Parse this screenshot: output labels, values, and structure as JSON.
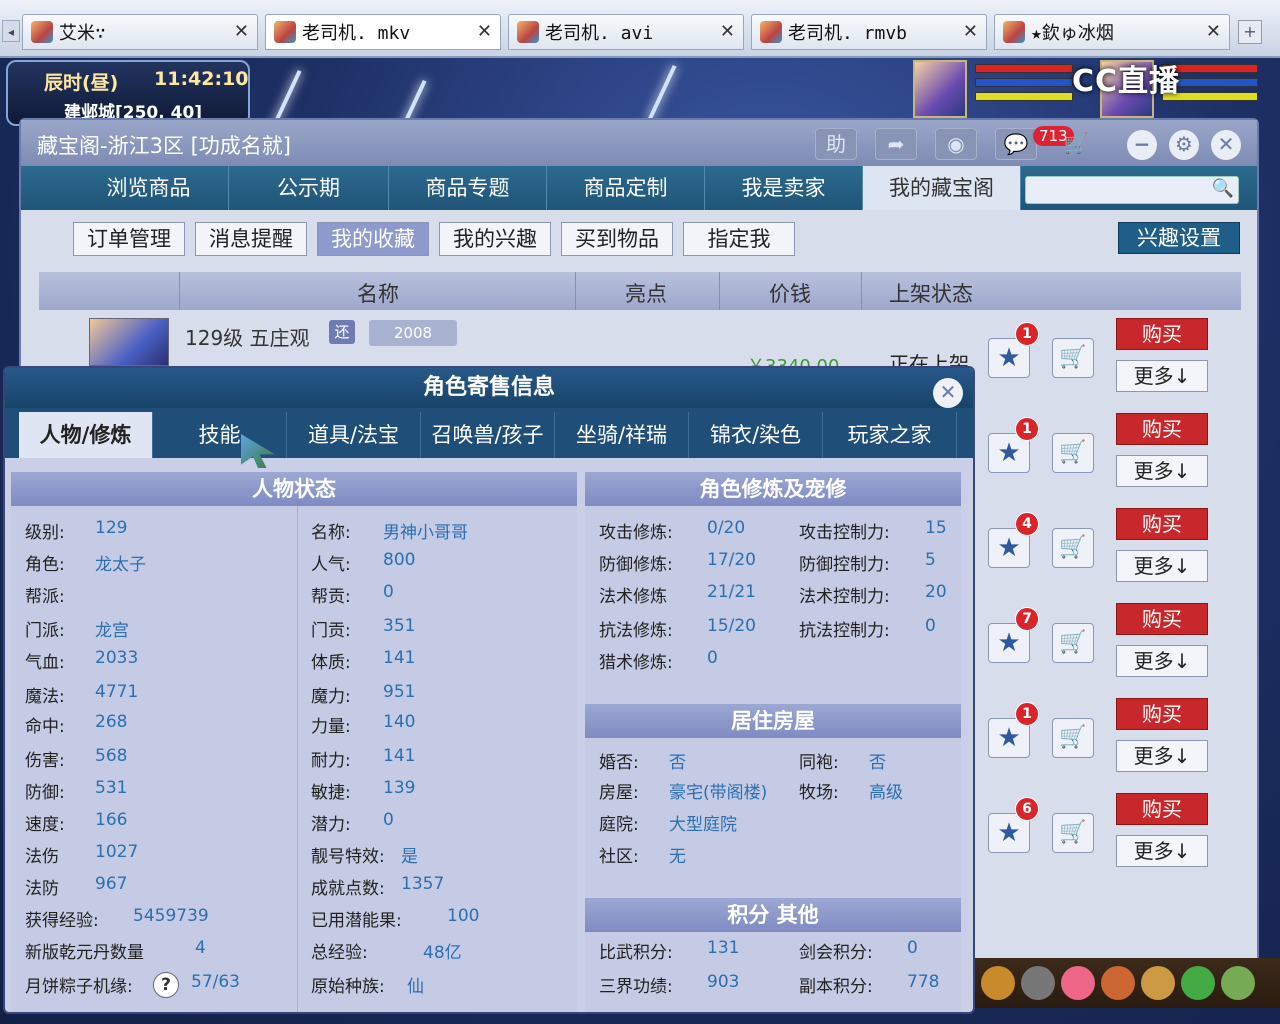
{
  "browser_tabs": [
    {
      "label": "艾米∵",
      "active": false
    },
    {
      "label": "老司机. mkv",
      "active": true
    },
    {
      "label": "老司机. avi",
      "active": false
    },
    {
      "label": "老司机. rmvb",
      "active": false
    },
    {
      "label": "★欽ゅ冰烟",
      "active": false
    }
  ],
  "hud": {
    "period": "辰时(昼)",
    "time": "11:42:10",
    "location": "建邺城[250, 40]",
    "watermark": "CC直播"
  },
  "window": {
    "title": "藏宝阁-浙江3区 [功成名就]",
    "help_label": "助",
    "message_count": "713"
  },
  "nav": {
    "items": [
      "浏览商品",
      "公示期",
      "商品专题",
      "商品定制",
      "我是卖家",
      "我的藏宝阁"
    ],
    "active_index": 5
  },
  "subnav": {
    "items": [
      "订单管理",
      "消息提醒",
      "我的收藏",
      "我的兴趣",
      "买到物品",
      "指定我"
    ],
    "active_index": 2,
    "interest_settings": "兴趣设置"
  },
  "list": {
    "headers": [
      "名称",
      "亮点",
      "价钱",
      "上架状态"
    ],
    "first_item": {
      "name": "129级 五庄观",
      "tag": "还",
      "year": "2008",
      "price": "￥3340.00",
      "status": "正在上架"
    },
    "rows": [
      {
        "badge": "1",
        "buy": "购买",
        "more": "更多↓"
      },
      {
        "badge": "1",
        "buy": "购买",
        "more": "更多↓"
      },
      {
        "badge": "4",
        "buy": "购买",
        "more": "更多↓"
      },
      {
        "badge": "7",
        "buy": "购买",
        "more": "更多↓"
      },
      {
        "badge": "1",
        "buy": "购买",
        "more": "更多↓"
      },
      {
        "badge": "6",
        "buy": "购买",
        "more": "更多↓"
      }
    ]
  },
  "dialog": {
    "title": "角色寄售信息",
    "tabs": [
      "人物/修炼",
      "技能",
      "道具/法宝",
      "召唤兽/孩子",
      "坐骑/祥瑞",
      "锦衣/染色",
      "玩家之家"
    ],
    "active_tab": 0,
    "char_status_title": "人物状态",
    "char_left": [
      {
        "k": "级别:",
        "v": "129"
      },
      {
        "k": "角色:",
        "v": "龙太子"
      },
      {
        "k": "帮派:",
        "v": ""
      },
      {
        "k": "门派:",
        "v": "龙宫"
      },
      {
        "k": "气血:",
        "v": "2033"
      },
      {
        "k": "魔法:",
        "v": "4771"
      },
      {
        "k": "命中:",
        "v": "268"
      },
      {
        "k": "伤害:",
        "v": "568"
      },
      {
        "k": "防御:",
        "v": "531"
      },
      {
        "k": "速度:",
        "v": "166"
      },
      {
        "k": "法伤",
        "v": "1027"
      },
      {
        "k": "法防",
        "v": "967"
      },
      {
        "k": "获得经验:",
        "v": "5459739"
      },
      {
        "k": "新版乾元丹数量",
        "v": "4"
      },
      {
        "k": "月饼粽子机缘:",
        "v": "57/63"
      }
    ],
    "char_right": [
      {
        "k": "名称:",
        "v": "男神小哥哥"
      },
      {
        "k": "人气:",
        "v": "800"
      },
      {
        "k": "帮贡:",
        "v": "0"
      },
      {
        "k": "门贡:",
        "v": "351"
      },
      {
        "k": "体质:",
        "v": "141"
      },
      {
        "k": "魔力:",
        "v": "951"
      },
      {
        "k": "力量:",
        "v": "140"
      },
      {
        "k": "耐力:",
        "v": "141"
      },
      {
        "k": "敏捷:",
        "v": "139"
      },
      {
        "k": "潜力:",
        "v": "0"
      },
      {
        "k": "靓号特效:",
        "v": "是"
      },
      {
        "k": "成就点数:",
        "v": "1357"
      },
      {
        "k": "已用潜能果:",
        "v": "100"
      },
      {
        "k": "总经验:",
        "v": "48亿"
      },
      {
        "k": "原始种族:",
        "v": "仙"
      }
    ],
    "cultivation_title": "角色修炼及宠修",
    "cultivation": [
      {
        "k": "攻击修炼:",
        "v": "0/20",
        "k2": "攻击控制力:",
        "v2": "15"
      },
      {
        "k": "防御修炼:",
        "v": "17/20",
        "k2": "防御控制力:",
        "v2": "5"
      },
      {
        "k": "法术修炼",
        "v": "21/21",
        "k2": "法术控制力:",
        "v2": "20"
      },
      {
        "k": "抗法修炼:",
        "v": "15/20",
        "k2": "抗法控制力:",
        "v2": "0"
      },
      {
        "k": "猎术修炼:",
        "v": "0",
        "k2": "",
        "v2": ""
      }
    ],
    "house_title": "居住房屋",
    "house": [
      {
        "k": "婚否:",
        "v": "否",
        "k2": "同袍:",
        "v2": "否"
      },
      {
        "k": "房屋:",
        "v": "豪宅(带阁楼)",
        "k2": "牧场:",
        "v2": "高级"
      },
      {
        "k": "庭院:",
        "v": "大型庭院",
        "k2": "",
        "v2": ""
      },
      {
        "k": "社区:",
        "v": "无",
        "k2": "",
        "v2": ""
      }
    ],
    "points_title": "积分 其他",
    "points": [
      {
        "k": "比武积分:",
        "v": "131",
        "k2": "剑会积分:",
        "v2": "0"
      },
      {
        "k": "三界功绩:",
        "v": "903",
        "k2": "副本积分:",
        "v2": "778"
      }
    ]
  },
  "colors": {
    "nav_bg": "#1f5578",
    "buy_red": "#c8282c",
    "value_blue": "#2b6fb0",
    "badge_red": "#d9242a"
  }
}
